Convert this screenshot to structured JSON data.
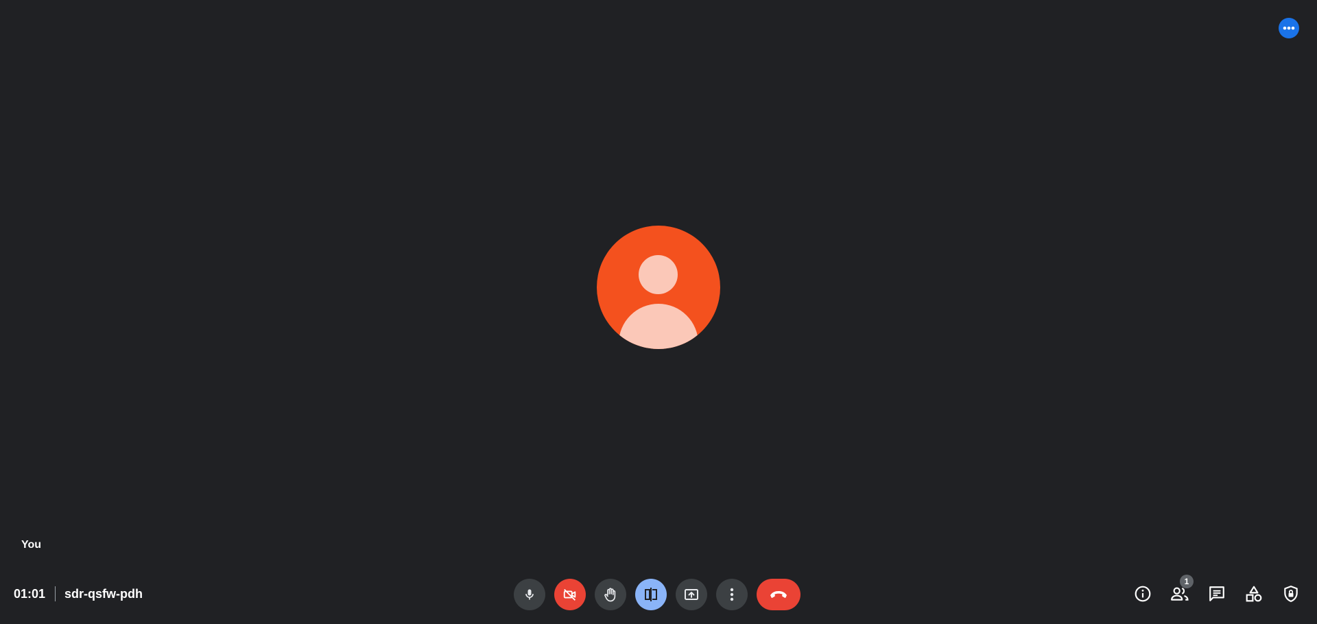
{
  "top_right": {
    "more_icon": "more-horizontal-icon",
    "color": "#1a73e8"
  },
  "participant": {
    "self_label": "You",
    "avatar_color": "#f4511e",
    "avatar_icon": "person-silhouette-icon"
  },
  "meeting": {
    "time": "01:01",
    "code": "sdr-qsfw-pdh"
  },
  "controls": [
    {
      "name": "microphone",
      "icon": "mic-icon",
      "state": "on"
    },
    {
      "name": "camera",
      "icon": "videocam-off-icon",
      "state": "off"
    },
    {
      "name": "raise-hand",
      "icon": "hand-icon"
    },
    {
      "name": "companion-mode",
      "icon": "companion-icon",
      "state": "active"
    },
    {
      "name": "present",
      "icon": "present-screen-icon"
    },
    {
      "name": "more-options",
      "icon": "more-vertical-icon"
    },
    {
      "name": "leave-call",
      "icon": "call-end-icon"
    }
  ],
  "side_panel_buttons": [
    {
      "name": "meeting-details",
      "icon": "info-icon"
    },
    {
      "name": "people",
      "icon": "people-icon",
      "badge": "1"
    },
    {
      "name": "chat",
      "icon": "chat-icon"
    },
    {
      "name": "activities",
      "icon": "activities-icon"
    },
    {
      "name": "host-controls",
      "icon": "shield-lock-icon"
    }
  ],
  "colors": {
    "background": "#202124",
    "button": "#3c4043",
    "danger": "#ea4335",
    "active": "#8ab4f8"
  }
}
